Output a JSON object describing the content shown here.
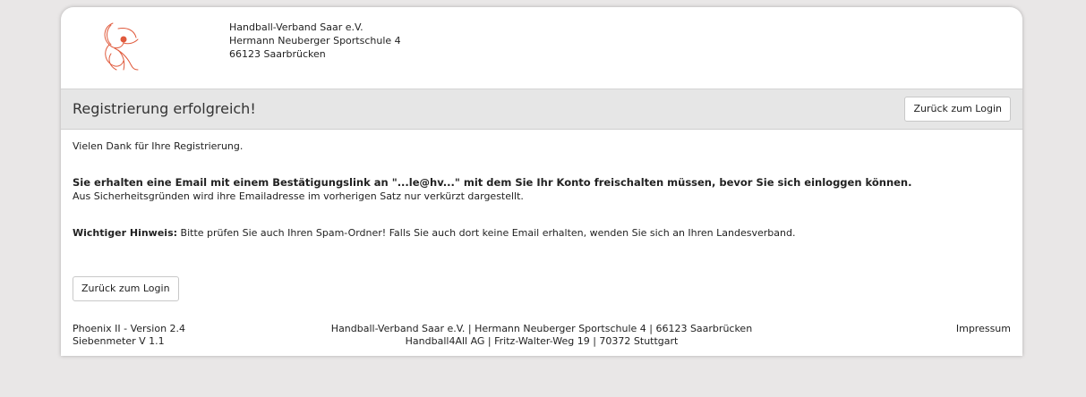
{
  "header": {
    "org_name": "Handball-Verband Saar e.V.",
    "street": "Hermann Neuberger Sportschule 4",
    "city": "66123 Saarbrücken",
    "logo_icon": "handball-player-logo",
    "logo_color": "#e05a3c"
  },
  "titlebar": {
    "title": "Registrierung erfolgreich!",
    "back_button": "Zurück zum Login"
  },
  "content": {
    "thanks": "Vielen Dank für Ihre Registrierung.",
    "email_notice": "Sie erhalten eine Email mit einem Bestätigungslink an \"...le@hv...\" mit dem Sie Ihr Konto freischalten müssen, bevor Sie sich einloggen können.",
    "security_note": "Aus Sicherheitsgründen wird ihre Emailadresse im vorherigen Satz nur verkürzt dargestellt.",
    "important_label": "Wichtiger Hinweis:",
    "important_text": " Bitte prüfen Sie auch Ihren Spam-Ordner! Falls Sie auch dort keine Email erhalten, wenden Sie sich an Ihren Landesverband.",
    "back_button": "Zurück zum Login"
  },
  "footer": {
    "version": "Phoenix II - Version 2.4",
    "sub_version": "Siebenmeter V 1.1",
    "address_line1": "Handball-Verband Saar e.V. | Hermann Neuberger Sportschule 4 | 66123 Saarbrücken",
    "address_line2": "Handball4All AG | Fritz-Walter-Weg 19 | 70372 Stuttgart",
    "impressum": "Impressum"
  }
}
